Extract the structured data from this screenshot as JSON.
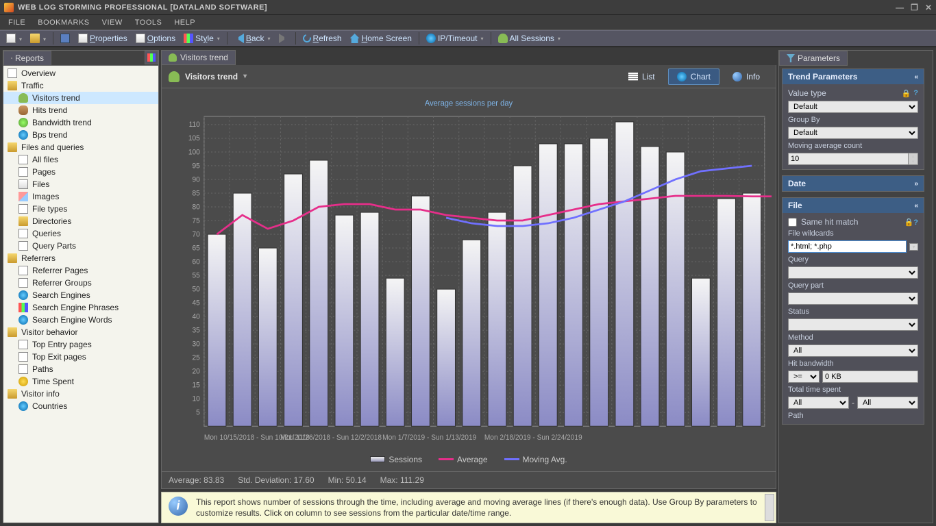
{
  "app_title": "WEB LOG STORMING PROFESSIONAL [DATALAND SOFTWARE]",
  "menu": [
    "FILE",
    "BOOKMARKS",
    "VIEW",
    "TOOLS",
    "HELP"
  ],
  "toolbar": {
    "properties": "Properties",
    "options": "Options",
    "style": "Style",
    "back": "Back",
    "refresh": "Refresh",
    "home": "Home Screen",
    "ip": "IP/Timeout",
    "sessions": "All Sessions"
  },
  "reports_title": "Reports",
  "tree": [
    {
      "d": 0,
      "ico": "ic-page",
      "label": "Overview"
    },
    {
      "d": 0,
      "ico": "ic-folder",
      "label": "Traffic",
      "cat": true
    },
    {
      "d": 1,
      "ico": "ic-people",
      "label": "Visitors trend",
      "sel": true
    },
    {
      "d": 1,
      "ico": "ic-db",
      "label": "Hits trend"
    },
    {
      "d": 1,
      "ico": "ic-search",
      "label": "Bandwidth trend"
    },
    {
      "d": 1,
      "ico": "ic-globe",
      "label": "Bps trend"
    },
    {
      "d": 0,
      "ico": "ic-folder",
      "label": "Files and queries",
      "cat": true
    },
    {
      "d": 1,
      "ico": "ic-page",
      "label": "All files"
    },
    {
      "d": 1,
      "ico": "ic-page",
      "label": "Pages"
    },
    {
      "d": 1,
      "ico": "ic-file",
      "label": "Files"
    },
    {
      "d": 1,
      "ico": "ic-img",
      "label": "Images"
    },
    {
      "d": 1,
      "ico": "ic-page",
      "label": "File types"
    },
    {
      "d": 1,
      "ico": "ic-folder",
      "label": "Directories"
    },
    {
      "d": 1,
      "ico": "ic-page",
      "label": "Queries"
    },
    {
      "d": 1,
      "ico": "ic-page",
      "label": "Query Parts"
    },
    {
      "d": 0,
      "ico": "ic-folder",
      "label": "Referrers",
      "cat": true
    },
    {
      "d": 1,
      "ico": "ic-page",
      "label": "Referrer Pages"
    },
    {
      "d": 1,
      "ico": "ic-page",
      "label": "Referrer Groups"
    },
    {
      "d": 1,
      "ico": "ic-globe",
      "label": "Search Engines"
    },
    {
      "d": 1,
      "ico": "ic-chart",
      "label": "Search Engine Phrases"
    },
    {
      "d": 1,
      "ico": "ic-globe",
      "label": "Search Engine Words"
    },
    {
      "d": 0,
      "ico": "ic-folder",
      "label": "Visitor behavior",
      "cat": true
    },
    {
      "d": 1,
      "ico": "ic-page",
      "label": "Top Entry pages"
    },
    {
      "d": 1,
      "ico": "ic-page",
      "label": "Top Exit pages"
    },
    {
      "d": 1,
      "ico": "ic-page",
      "label": "Paths"
    },
    {
      "d": 1,
      "ico": "ic-clock",
      "label": "Time Spent"
    },
    {
      "d": 0,
      "ico": "ic-folder",
      "label": "Visitor info",
      "cat": true
    },
    {
      "d": 1,
      "ico": "ic-globe",
      "label": "Countries"
    }
  ],
  "report": {
    "tab": "Visitors trend",
    "title": "Visitors trend",
    "btn_list": "List",
    "btn_chart": "Chart",
    "btn_info": "Info"
  },
  "chart_data": {
    "type": "bar",
    "title": "Average sessions per day",
    "ylim": [
      0,
      113
    ],
    "yticks": [
      5,
      10,
      15,
      20,
      25,
      30,
      35,
      40,
      45,
      50,
      55,
      60,
      65,
      70,
      75,
      80,
      85,
      90,
      95,
      100,
      105,
      110
    ],
    "categories": [
      "Mon 10/15/2018 - Sun 10/21/2018",
      "",
      "",
      "Mon 11/26/2018 - Sun 12/2/2018",
      "",
      "",
      "",
      "Mon 1/7/2019 - Sun 1/13/2019",
      "",
      "",
      "",
      "Mon 2/18/2019 - Sun 2/24/2019",
      "",
      ""
    ],
    "x_tick_idx": [
      0,
      3,
      7,
      11
    ],
    "series": [
      {
        "name": "Sessions",
        "type": "bar",
        "values": [
          70,
          85,
          65,
          92,
          97,
          77,
          78,
          54,
          84,
          50,
          68,
          78,
          95,
          103,
          103,
          105,
          111,
          102,
          100,
          54,
          83,
          85
        ]
      },
      {
        "name": "Average",
        "type": "line",
        "values": [
          70,
          77,
          72,
          75,
          80,
          81,
          81,
          79,
          79,
          77,
          76,
          75,
          75,
          77,
          79,
          81,
          82,
          83,
          84,
          84,
          84,
          83.8,
          83.8
        ]
      },
      {
        "name": "Moving Avg.",
        "type": "line",
        "start": 9,
        "values": [
          76,
          74,
          73,
          73,
          74,
          76,
          79,
          82,
          86,
          90,
          93,
          94,
          95
        ]
      }
    ],
    "legend": [
      "Sessions",
      "Average",
      "Moving Avg."
    ]
  },
  "stats": {
    "avg": "Average: 83.83",
    "std": "Std. Deviation: 17.60",
    "min": "Min: 50.14",
    "max": "Max: 111.29"
  },
  "info_text": "This report shows number of sessions through the time, including average and moving average lines (if there's enough data). Use Group By parameters to customize results. Click on column to see sessions from the particular date/time range.",
  "params": {
    "title": "Parameters",
    "g_trend": "Trend Parameters",
    "value_type": "Value type",
    "value_type_v": "Default",
    "group_by": "Group By",
    "group_by_v": "Default",
    "mavg": "Moving average count",
    "mavg_v": "10",
    "g_date": "Date",
    "g_file": "File",
    "same_hit": "Same hit match",
    "wildcards": "File wildcards",
    "wildcards_v": "*.html; *.php",
    "query": "Query",
    "query_part": "Query part",
    "status": "Status",
    "method": "Method",
    "method_v": "All",
    "hit_bw": "Hit bandwidth",
    "hit_bw_op": ">=",
    "hit_bw_v": "0 KB",
    "tts": "Total time spent",
    "tts_v": "All",
    "path": "Path"
  }
}
